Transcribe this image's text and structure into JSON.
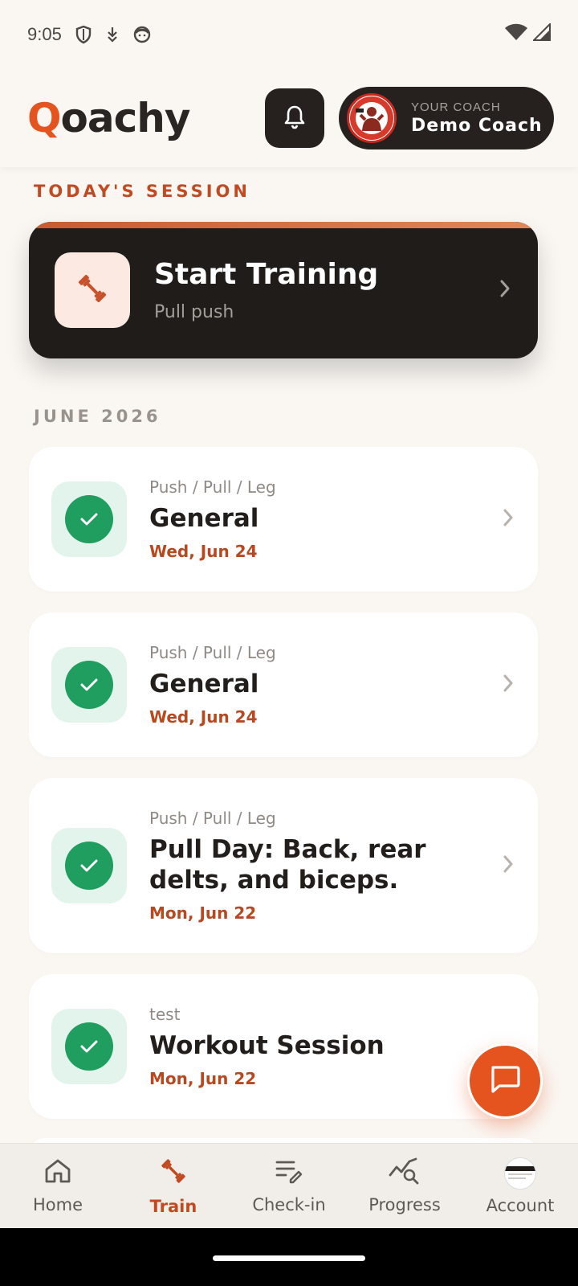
{
  "status_bar": {
    "time": "9:05"
  },
  "header": {
    "logo_q": "Q",
    "logo_rest": "oachy",
    "coach_label": "YOUR COACH",
    "coach_name": "Demo Coach"
  },
  "today": {
    "section_label": "TODAY'S SESSION",
    "title": "Start Training",
    "subtitle": "Pull push"
  },
  "history": {
    "section_label": "JUNE 2026",
    "sessions": [
      {
        "program": "Push / Pull / Leg",
        "title": "General",
        "date": "Wed, Jun 24",
        "completed": true
      },
      {
        "program": "Push / Pull / Leg",
        "title": "General",
        "date": "Wed, Jun 24",
        "completed": true
      },
      {
        "program": "Push / Pull / Leg",
        "title": "Pull Day: Back, rear delts, and biceps.",
        "date": "Mon, Jun 22",
        "completed": true
      },
      {
        "program": "test",
        "title": "Workout Session",
        "date": "Mon, Jun 22",
        "completed": true
      }
    ]
  },
  "bottom_nav": {
    "items": [
      {
        "label": "Home",
        "icon": "home-icon",
        "active": false
      },
      {
        "label": "Train",
        "icon": "dumbbell-icon",
        "active": true
      },
      {
        "label": "Check-in",
        "icon": "checkin-icon",
        "active": false
      },
      {
        "label": "Progress",
        "icon": "progress-icon",
        "active": false
      },
      {
        "label": "Account",
        "icon": "account-avatar",
        "active": false
      }
    ]
  },
  "colors": {
    "accent": "#e5531f",
    "dark_card": "#1f1c1a",
    "success": "#1f9e5f",
    "date_text": "#b8481f"
  }
}
